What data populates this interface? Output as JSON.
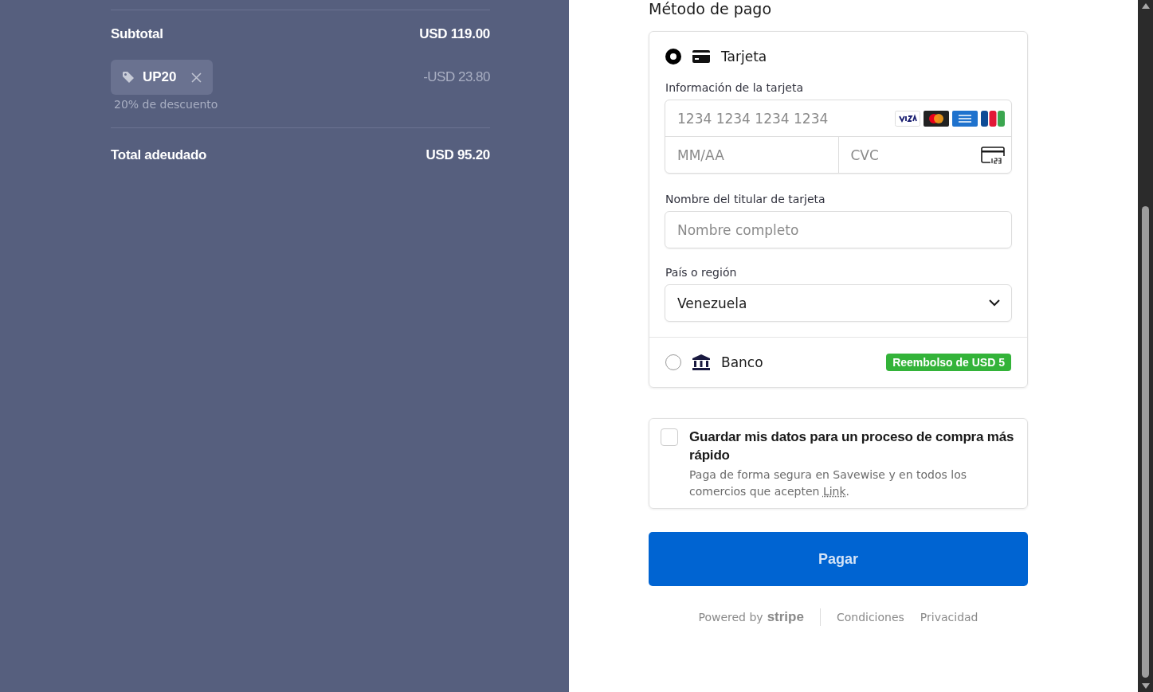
{
  "summary": {
    "subtotal": {
      "label": "Subtotal",
      "amount": "USD 119.00"
    },
    "discount": {
      "code": "UP20",
      "description": "20% de descuento",
      "amount": "-USD 23.80"
    },
    "total": {
      "label": "Total adeudado",
      "amount": "USD 95.20"
    }
  },
  "payment": {
    "title": "Método de pago",
    "methods": [
      {
        "kind": "card",
        "label": "Tarjeta",
        "selected": true
      },
      {
        "kind": "bank",
        "label": "Banco",
        "selected": false,
        "badge": "Reembolso de USD 5"
      }
    ],
    "card_info_label": "Información de la tarjeta",
    "number_placeholder": "1234 1234 1234 1234",
    "expiry_placeholder": "MM/AA",
    "cvc_placeholder": "CVC",
    "holder_label": "Nombre del titular de tarjeta",
    "holder_placeholder": "Nombre completo",
    "country_label": "País o región",
    "country_value": "Venezuela"
  },
  "save": {
    "checked": false,
    "title": "Guardar mis datos para un proceso de compra más rápido",
    "description": "Paga de forma segura en Savewise y en todos los comercios que acepten",
    "link": "Link",
    "after_link": "."
  },
  "pay_button": "Pagar",
  "footer": {
    "powered": "Powered by",
    "brand": "stripe",
    "links": [
      "Condiciones",
      "Privacidad"
    ]
  }
}
